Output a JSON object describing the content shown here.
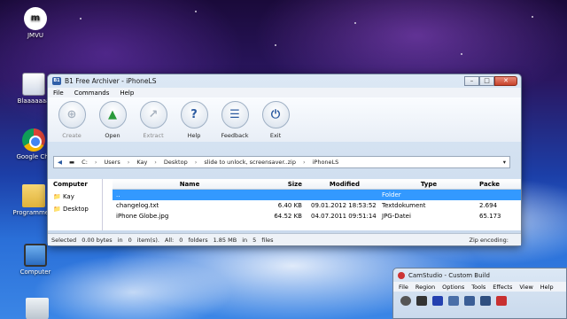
{
  "desktop": {
    "icons": [
      {
        "label": "JMVU"
      },
      {
        "label": "Blaaaaaaa"
      },
      {
        "label": "Google Chr"
      },
      {
        "label": "Programme a"
      },
      {
        "label": "Computer"
      }
    ]
  },
  "window": {
    "title": "B1 Free Archiver - iPhoneLS",
    "app_icon_text": "B1",
    "menu": [
      "File",
      "Commands",
      "Help"
    ],
    "toolbar": [
      {
        "label": "Create",
        "icon": "create-icon",
        "enabled": false
      },
      {
        "label": "Open",
        "icon": "open-icon",
        "enabled": true
      },
      {
        "label": "Extract",
        "icon": "extract-icon",
        "enabled": false
      },
      {
        "label": "Help",
        "icon": "help-icon",
        "enabled": true
      },
      {
        "label": "Feedback",
        "icon": "feedback-icon",
        "enabled": true
      },
      {
        "label": "Exit",
        "icon": "power-icon",
        "enabled": true
      }
    ],
    "address": [
      "C:",
      "Users",
      "Kay",
      "Desktop",
      "slide to unlock, screensaver..zip",
      "iPhoneLS"
    ],
    "tree": {
      "header": "Computer",
      "items": [
        "Kay",
        "Desktop"
      ]
    },
    "columns": {
      "name": "Name",
      "size": "Size",
      "modified": "Modified",
      "type": "Type",
      "packed": "Packe"
    },
    "rows": [
      {
        "name": "..",
        "size": "",
        "modified": "",
        "type": "Folder",
        "packed": "",
        "selected": true
      },
      {
        "name": "changelog.txt",
        "size": "6.40 KB",
        "modified": "09.01.2012 18:53:52",
        "type": "Textdokument",
        "packed": "2.694",
        "selected": false
      },
      {
        "name": "iPhone Globe.jpg",
        "size": "64.52 KB",
        "modified": "04.07.2011 09:51:14",
        "type": "JPG-Datei",
        "packed": "65.173",
        "selected": false
      }
    ],
    "status": {
      "selected": "Selected",
      "sel_bytes": "0.00 bytes",
      "in1": "in",
      "sel_items": "0",
      "items_label": "item(s).",
      "all": "All:",
      "folders_n": "0",
      "folders_label": "folders",
      "total": "1.85 MB",
      "in2": "in",
      "files_n": "5",
      "files_label": "files",
      "zip": "Zip encoding:"
    }
  },
  "camstudio": {
    "title": "CamStudio - Custom Build",
    "menu": [
      "File",
      "Region",
      "Options",
      "Tools",
      "Effects",
      "View",
      "Help"
    ]
  }
}
